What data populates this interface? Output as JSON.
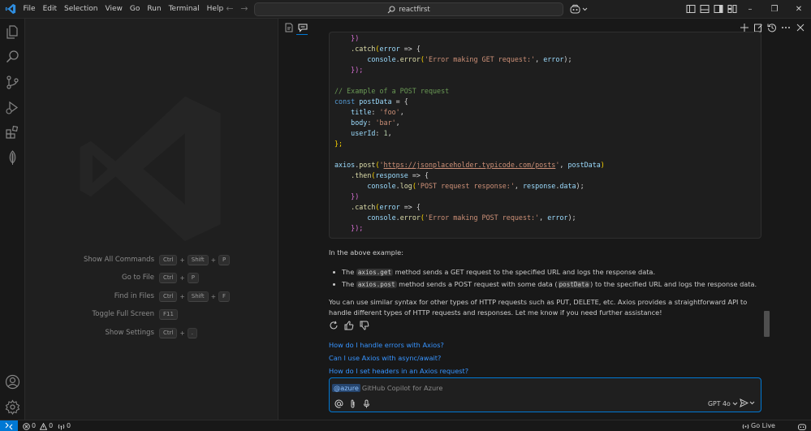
{
  "menu": [
    "File",
    "Edit",
    "Selection",
    "View",
    "Go",
    "Run",
    "Terminal",
    "Help"
  ],
  "search": {
    "text": "reactfirst"
  },
  "shortcuts": [
    {
      "label": "Show All Commands",
      "keys": [
        "Ctrl",
        "Shift",
        "P"
      ]
    },
    {
      "label": "Go to File",
      "keys": [
        "Ctrl",
        "P"
      ]
    },
    {
      "label": "Find in Files",
      "keys": [
        "Ctrl",
        "Shift",
        "F"
      ]
    },
    {
      "label": "Toggle Full Screen",
      "keys": [
        "F11"
      ]
    },
    {
      "label": "Show Settings",
      "keys": [
        "Ctrl",
        "."
      ]
    }
  ],
  "code": {
    "l1": "    })",
    "l2a": "    .catch",
    "l2b": "(",
    "l2c": "error",
    "l2d": " => {",
    "l3a": "        console",
    "l3b": ".",
    "l3c": "error",
    "l3d": "(",
    "l3e": "'Error making GET request:'",
    "l3f": ", ",
    "l3g": "error",
    "l3h": ");",
    "l4": "    });",
    "l6": "// Example of a POST request",
    "l7a": "const ",
    "l7b": "postData",
    "l7c": " = {",
    "l8a": "    title",
    "l8b": ": ",
    "l8c": "'foo'",
    "l8d": ",",
    "l9a": "    body",
    "l9b": ": ",
    "l9c": "'bar'",
    "l9d": ",",
    "l10a": "    userId",
    "l10b": ": ",
    "l10c": "1",
    "l10d": ",",
    "l11": "};",
    "l13a": "axios",
    "l13b": ".",
    "l13c": "post",
    "l13d": "(",
    "l13e": "'",
    "l13f": "https://jsonplaceholder.typicode.com/posts",
    "l13g": "'",
    "l13h": ", ",
    "l13i": "postData",
    "l13j": ")",
    "l14a": "    .then",
    "l14b": "(",
    "l14c": "response",
    "l14d": " => {",
    "l15a": "        console",
    "l15b": ".",
    "l15c": "log",
    "l15d": "(",
    "l15e": "'POST request response:'",
    "l15f": ", ",
    "l15g": "response",
    "l15h": ".",
    "l15i": "data",
    "l15j": ");",
    "l16": "    })",
    "l17a": "    .catch",
    "l17b": "(",
    "l17c": "error",
    "l17d": " => {",
    "l18a": "        console",
    "l18b": ".",
    "l18c": "error",
    "l18d": "(",
    "l18e": "'Error making POST request:'",
    "l18f": ", ",
    "l18g": "error",
    "l18h": ");",
    "l19": "    });"
  },
  "chat": {
    "intro": "In the above example:",
    "bullet1_pre": "The ",
    "bullet1_code": "axios.get",
    "bullet1_post": " method sends a GET request to the specified URL and logs the response data.",
    "bullet2_pre": "The ",
    "bullet2_code": "axios.post",
    "bullet2_mid": " method sends a POST request with some data (",
    "bullet2_code2": "postData",
    "bullet2_post": ") to the specified URL and logs the response data.",
    "closing": "You can use similar syntax for other types of HTTP requests such as PUT, DELETE, etc. Axios provides a straightforward API to handle different types of HTTP requests and responses. Let me know if you need further assistance!",
    "followups": [
      "How do I handle errors with Axios?",
      "Can I use Axios with async/await?",
      "How do I set headers in an Axios request?"
    ],
    "mention": "@azure",
    "placeholder": "GitHub Copilot for Azure",
    "model": "GPT 4o"
  },
  "status": {
    "errors": "0",
    "warnings": "0",
    "ports": "0",
    "golive": "Go Live"
  },
  "colors": {
    "accent": "#0078d4",
    "link": "#3794ff"
  }
}
